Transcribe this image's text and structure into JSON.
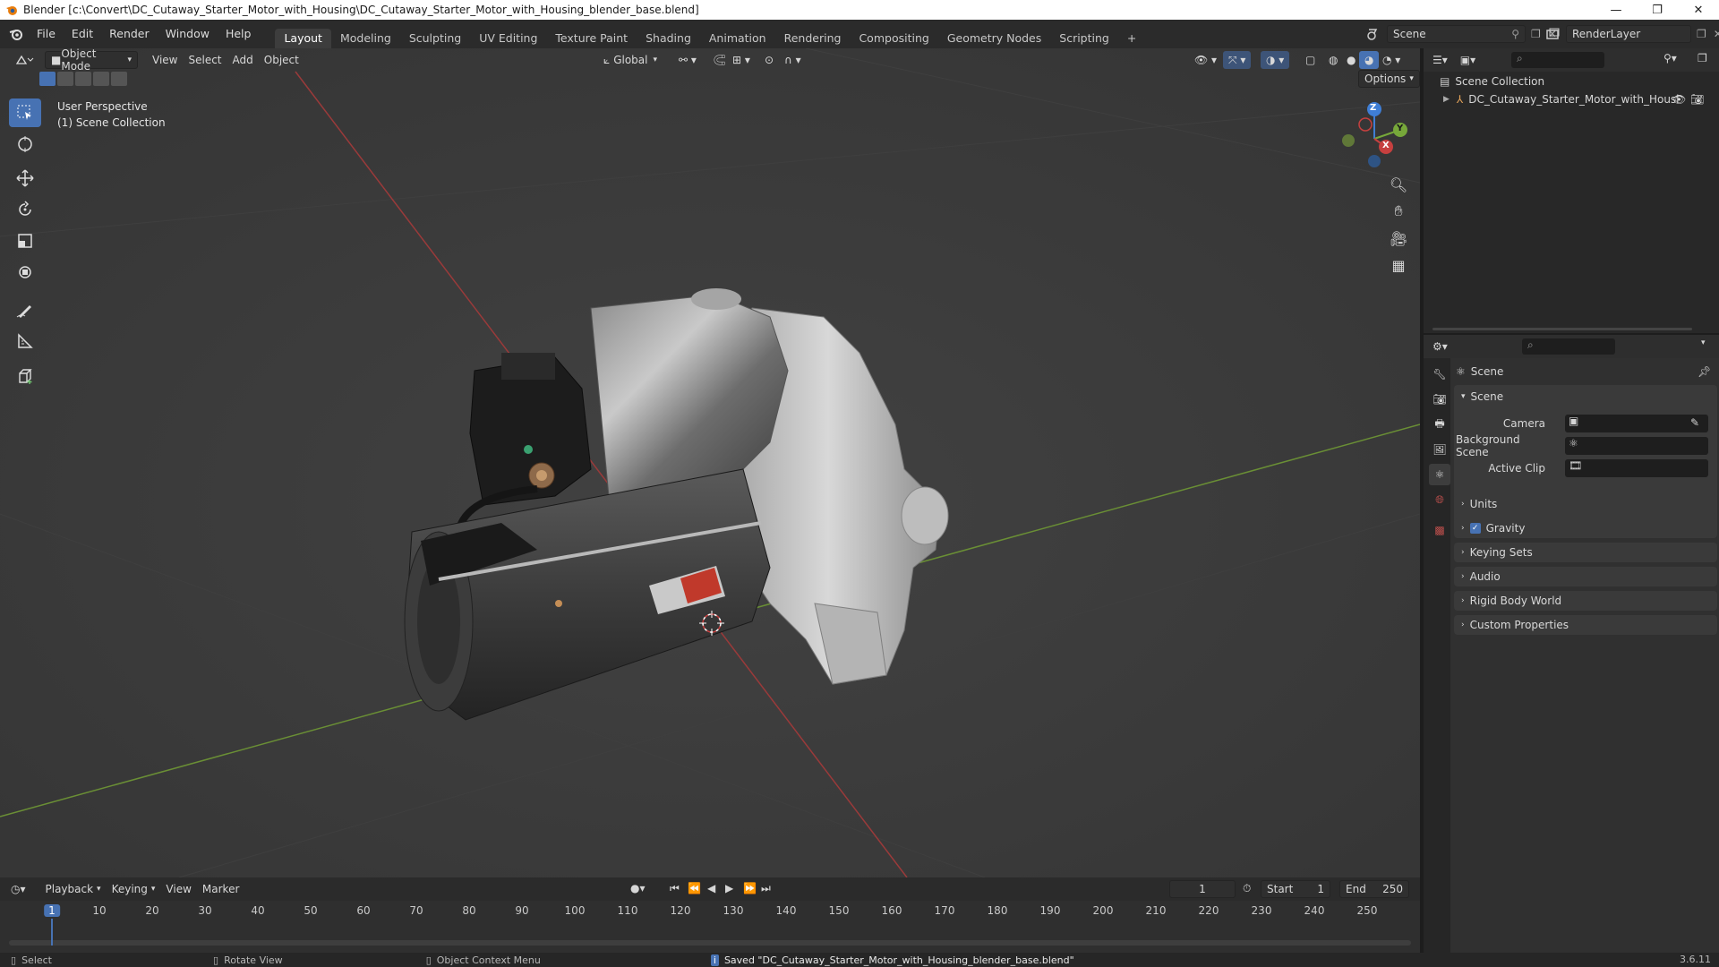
{
  "window": {
    "title": "Blender [c:\\Convert\\DC_Cutaway_Starter_Motor_with_Housing\\DC_Cutaway_Starter_Motor_with_Housing_blender_base.blend]",
    "minimize": "—",
    "maximize": "❐",
    "close": "✕"
  },
  "menu": [
    "File",
    "Edit",
    "Render",
    "Window",
    "Help"
  ],
  "workspaces": [
    "Layout",
    "Modeling",
    "Sculpting",
    "UV Editing",
    "Texture Paint",
    "Shading",
    "Animation",
    "Rendering",
    "Compositing",
    "Geometry Nodes",
    "Scripting"
  ],
  "active_workspace": "Layout",
  "add_workspace": "+",
  "scene_selector": "Scene",
  "render_layer": "RenderLayer",
  "viewport_header": {
    "mode": "Object Mode",
    "menus": [
      "View",
      "Select",
      "Add",
      "Object"
    ],
    "transform_orientation": "Global",
    "options": "Options"
  },
  "viewport_overlay": {
    "perspective": "User Perspective",
    "collection": "(1) Scene Collection"
  },
  "gizmo": {
    "x": "X",
    "y": "Y",
    "z": "Z"
  },
  "outliner": {
    "root": "Scene Collection",
    "item": "DC_Cutaway_Starter_Motor_with_Housi"
  },
  "properties": {
    "context": "Scene",
    "panel_scene": "Scene",
    "camera_label": "Camera",
    "background_scene_label": "Background Scene",
    "active_clip_label": "Active Clip",
    "sections": [
      "Units",
      "Gravity",
      "Keying Sets",
      "Audio",
      "Rigid Body World",
      "Custom Properties"
    ],
    "gravity_checked": true
  },
  "timeline": {
    "menus": [
      "Playback",
      "Keying",
      "View",
      "Marker"
    ],
    "current_frame": "1",
    "start_label": "Start",
    "start": "1",
    "end_label": "End",
    "end": "250",
    "frames": [
      "1",
      "10",
      "20",
      "30",
      "40",
      "50",
      "60",
      "70",
      "80",
      "90",
      "100",
      "110",
      "120",
      "130",
      "140",
      "150",
      "160",
      "170",
      "180",
      "190",
      "200",
      "210",
      "220",
      "230",
      "240",
      "250"
    ]
  },
  "statusbar": {
    "select": "Select",
    "rotate": "Rotate View",
    "context_menu": "Object Context Menu",
    "message": "Saved \"DC_Cutaway_Starter_Motor_with_Housing_blender_base.blend\"",
    "version": "3.6.11"
  },
  "colors": {
    "accent": "#4772b3",
    "x_axis": "#c6403f",
    "y_axis": "#77a83a",
    "z_axis": "#3f7ed5"
  }
}
